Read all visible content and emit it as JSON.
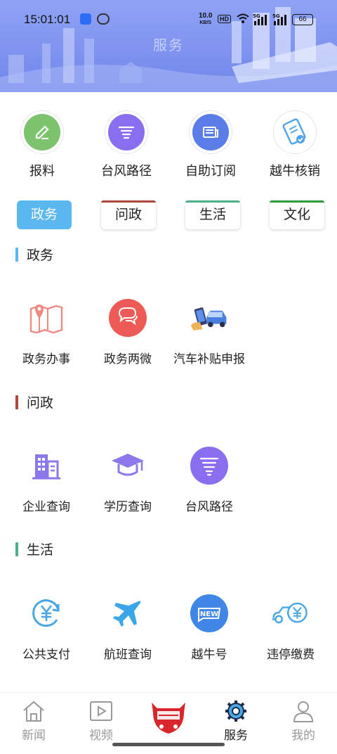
{
  "status_bar": {
    "time": "15:01:01",
    "net_speed": "10.0",
    "net_unit": "KB/S",
    "hd": "HD",
    "signal1": "5G",
    "signal2": "5G",
    "battery": "66"
  },
  "header": {
    "title": "服务"
  },
  "quick_actions": [
    {
      "label": "报料",
      "icon": "edit-icon",
      "color": "#7cc36e"
    },
    {
      "label": "台风路径",
      "icon": "typhoon-icon",
      "color": "#8a6ef0"
    },
    {
      "label": "自助订阅",
      "icon": "newspaper-icon",
      "color": "#5a7de8"
    },
    {
      "label": "越牛核销",
      "icon": "ticket-icon",
      "color": "#4fa3e8"
    }
  ],
  "tabs": [
    {
      "label": "政务",
      "color": "#5ab7ef",
      "active": true
    },
    {
      "label": "问政",
      "color": "#b04a3f",
      "active": false
    },
    {
      "label": "生活",
      "color": "#4fb08b",
      "active": false
    },
    {
      "label": "文化",
      "color": "#2f9a3a",
      "active": false
    }
  ],
  "sections": [
    {
      "title": "政务",
      "color": "#5ab7ef",
      "items": [
        {
          "label": "政务办事",
          "icon": "map-pin-icon"
        },
        {
          "label": "政务两微",
          "icon": "chat-bubbles-icon"
        },
        {
          "label": "汽车补贴申报",
          "icon": "car-phone-icon"
        }
      ]
    },
    {
      "title": "问政",
      "color": "#b04a3f",
      "items": [
        {
          "label": "企业查询",
          "icon": "building-icon"
        },
        {
          "label": "学历查询",
          "icon": "graduation-cap-icon"
        },
        {
          "label": "台风路径",
          "icon": "typhoon-icon"
        }
      ]
    },
    {
      "title": "生活",
      "color": "#4fb08b",
      "items": [
        {
          "label": "公共支付",
          "icon": "yuan-pay-icon"
        },
        {
          "label": "航班查询",
          "icon": "airplane-icon"
        },
        {
          "label": "越牛号",
          "icon": "new-badge-icon"
        },
        {
          "label": "违停缴费",
          "icon": "car-yuan-icon"
        }
      ]
    }
  ],
  "bottom_nav": [
    {
      "label": "新闻",
      "icon": "home-icon",
      "active": false
    },
    {
      "label": "视频",
      "icon": "video-icon",
      "active": false
    },
    {
      "label": "",
      "icon": "app-logo-icon",
      "active": false
    },
    {
      "label": "服务",
      "icon": "gear-icon",
      "active": true
    },
    {
      "label": "我的",
      "icon": "user-icon",
      "active": false
    }
  ]
}
